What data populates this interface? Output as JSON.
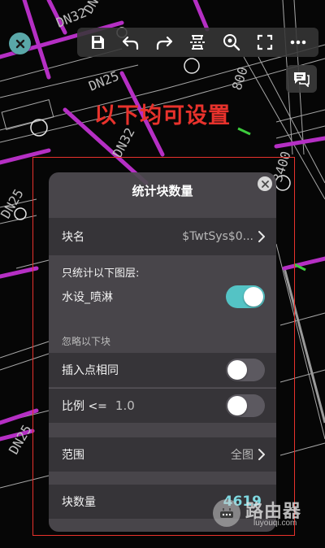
{
  "toolbar": {
    "items": [
      "save-icon",
      "undo-icon",
      "redo-icon",
      "measure-icon",
      "zoom-icon",
      "fullscreen-icon",
      "more-icon"
    ]
  },
  "annotation": {
    "text": "以下均可设置"
  },
  "dialog": {
    "title": "统计块数量",
    "block_name": {
      "label": "块名",
      "value": "$TwtSys$0..."
    },
    "layers": {
      "label": "只统计以下图层:",
      "layer_name": "水设_喷淋",
      "enabled": true
    },
    "ignore": {
      "section_label": "忽略以下块",
      "same_insert_label": "插入点相同",
      "same_insert_enabled": false,
      "ratio_label": "比例 <=",
      "ratio_value": "1.0",
      "ratio_enabled": false
    },
    "range": {
      "label": "范围",
      "value": "全图"
    },
    "count": {
      "label": "块数量",
      "value": "4619"
    }
  },
  "watermark": {
    "text": "路由器",
    "sub": "luyouqi.com"
  },
  "cad_labels": [
    "DN32",
    "DN25",
    "DN32",
    "DN25",
    "DN25",
    "DN25",
    "800",
    "3400"
  ],
  "colors": {
    "accent": "#54c3c5",
    "annotation": "#e8322c",
    "pipe": "#b52fc4"
  }
}
